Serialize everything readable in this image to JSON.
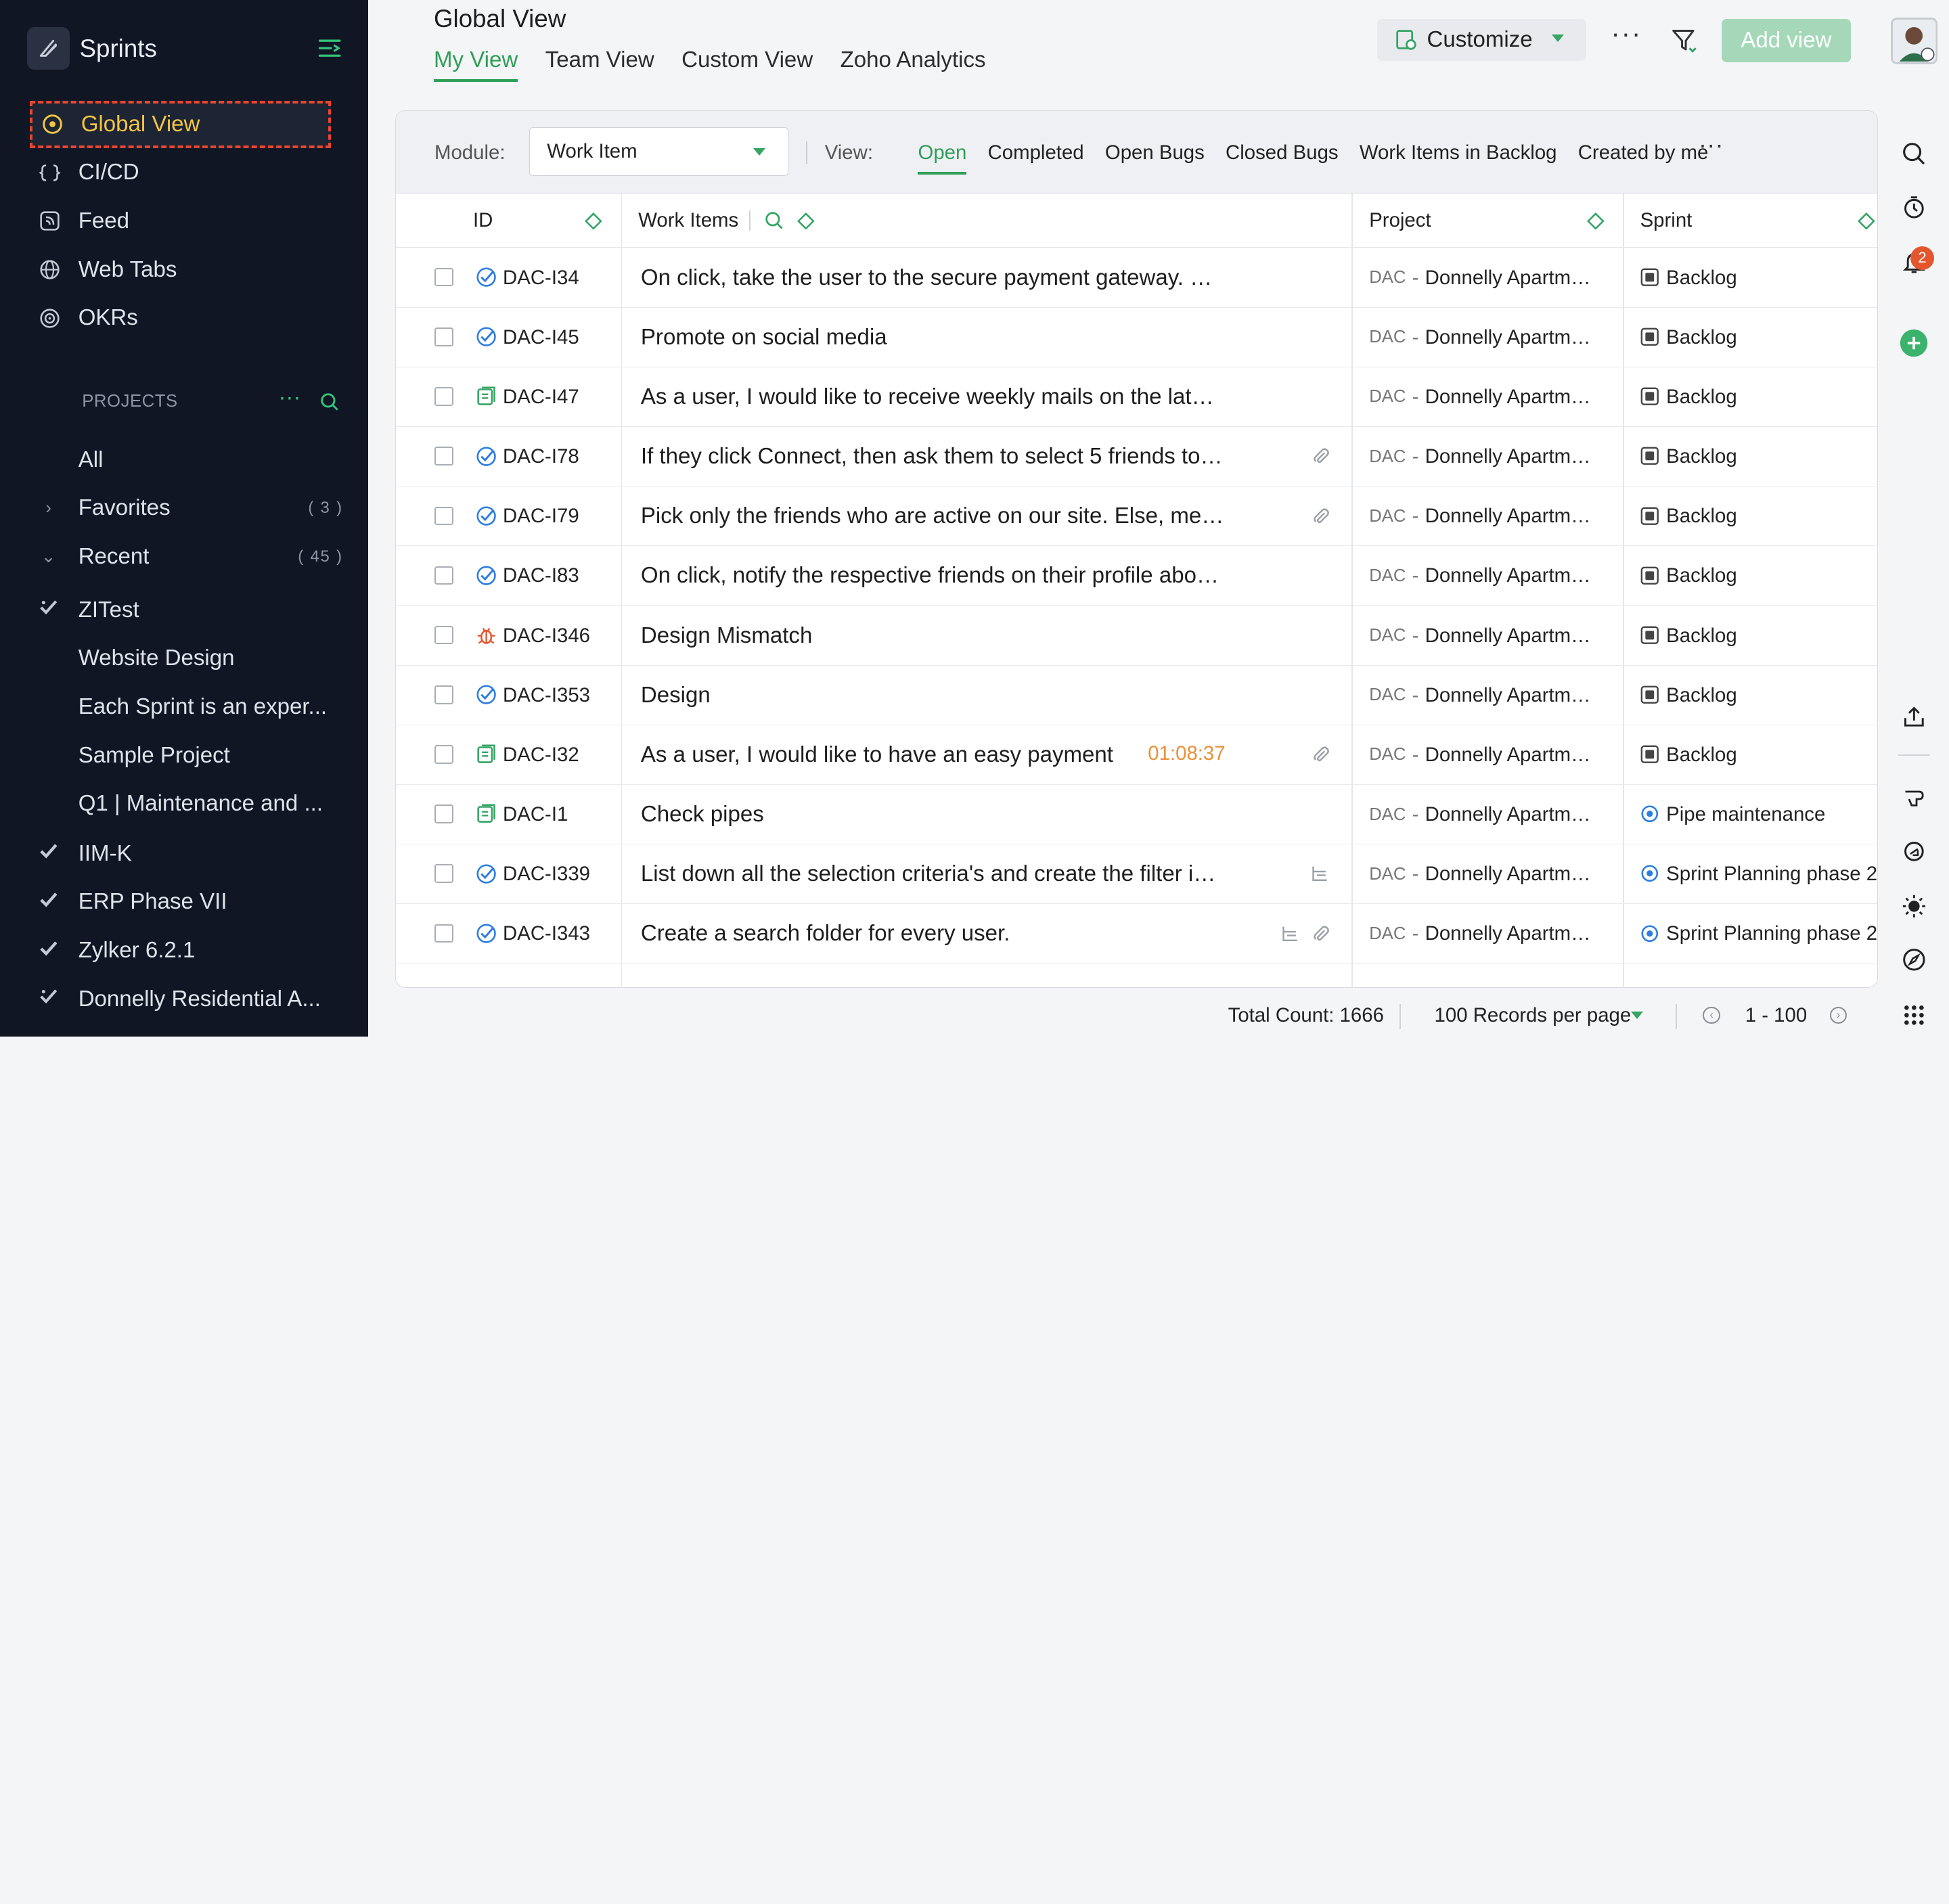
{
  "app": {
    "name": "Sprints"
  },
  "sidebar": {
    "nav": [
      {
        "label": "Global View",
        "icon": "eye-icon",
        "active": true
      },
      {
        "label": "CI/CD",
        "icon": "code-braces-icon"
      },
      {
        "label": "Feed",
        "icon": "feed-icon"
      },
      {
        "label": "Web Tabs",
        "icon": "globe-icon"
      },
      {
        "label": "OKRs",
        "icon": "target-icon"
      }
    ],
    "projects_heading": "PROJECTS",
    "groups": [
      {
        "label": "All"
      },
      {
        "label": "Favorites",
        "count": "( 3 )"
      },
      {
        "label": "Recent",
        "count": "( 45 )"
      }
    ],
    "projects": [
      {
        "label": "ZITest",
        "icon": "checkmark-star-icon"
      },
      {
        "label": "Website Design"
      },
      {
        "label": "Each Sprint is an exper..."
      },
      {
        "label": "Sample Project"
      },
      {
        "label": "Q1 | Maintenance and ..."
      },
      {
        "label": "IIM-K",
        "icon": "checkmark-icon"
      },
      {
        "label": "ERP Phase VII",
        "icon": "checkmark-icon"
      },
      {
        "label": "Zylker 6.2.1",
        "icon": "checkmark-icon"
      },
      {
        "label": "Donnelly Residential A...",
        "icon": "checkmark-star-icon"
      }
    ]
  },
  "header": {
    "title": "Global View",
    "tabs": [
      "My View",
      "Team View",
      "Custom View",
      "Zoho Analytics"
    ],
    "customize_label": "Customize",
    "add_view_label": "Add view"
  },
  "toolbar": {
    "module_label": "Module:",
    "module_value": "Work Item",
    "view_label": "View:",
    "views": [
      "Open",
      "Completed",
      "Open Bugs",
      "Closed Bugs",
      "Work Items in Backlog",
      "Created by me"
    ]
  },
  "table": {
    "columns": [
      "ID",
      "Work Items",
      "Project",
      "Sprint"
    ],
    "rows": [
      {
        "type": "task",
        "id": "DAC-I34",
        "title": "On click, take the user to the secure payment gateway. Che...",
        "project_prefix": "DAC",
        "project": "Donnelly Apartmen...",
        "sprint": "Backlog",
        "sprint_type": "backlog"
      },
      {
        "type": "task",
        "id": "DAC-I45",
        "title": "Promote on social media",
        "project_prefix": "DAC",
        "project": "Donnelly Apartmen...",
        "sprint": "Backlog",
        "sprint_type": "backlog"
      },
      {
        "type": "story",
        "id": "DAC-I47",
        "title": "As a user, I would like to receive weekly mails on the latest ...",
        "project_prefix": "DAC",
        "project": "Donnelly Apartmen...",
        "sprint": "Backlog",
        "sprint_type": "backlog"
      },
      {
        "type": "task",
        "id": "DAC-I78",
        "title": "If they click Connect, then ask them to select 5 friends to in...",
        "attach": true,
        "project_prefix": "DAC",
        "project": "Donnelly Apartmen...",
        "sprint": "Backlog",
        "sprint_type": "backlog"
      },
      {
        "type": "task",
        "id": "DAC-I79",
        "title": "Pick only the friends who are active on our site. Else, menti...",
        "attach": true,
        "project_prefix": "DAC",
        "project": "Donnelly Apartmen...",
        "sprint": "Backlog",
        "sprint_type": "backlog"
      },
      {
        "type": "task",
        "id": "DAC-I83",
        "title": "On click, notify the respective friends on their profile about...",
        "project_prefix": "DAC",
        "project": "Donnelly Apartmen...",
        "sprint": "Backlog",
        "sprint_type": "backlog"
      },
      {
        "type": "bug",
        "id": "DAC-I346",
        "title": "Design Mismatch",
        "project_prefix": "DAC",
        "project": "Donnelly Apartmen...",
        "sprint": "Backlog",
        "sprint_type": "backlog"
      },
      {
        "type": "task",
        "id": "DAC-I353",
        "title": "Design",
        "project_prefix": "DAC",
        "project": "Donnelly Apartmen...",
        "sprint": "Backlog",
        "sprint_type": "backlog"
      },
      {
        "type": "story",
        "id": "DAC-I32",
        "title": "As a user, I would like to have an easy payment",
        "timer": "01:08:37",
        "attach": true,
        "project_prefix": "DAC",
        "project": "Donnelly Apartmen...",
        "sprint": "Backlog",
        "sprint_type": "backlog"
      },
      {
        "type": "story",
        "id": "DAC-I1",
        "title": "Check pipes",
        "project_prefix": "DAC",
        "project": "Donnelly Apartmen...",
        "sprint": "Pipe maintenance",
        "sprint_type": "sprint"
      },
      {
        "type": "task",
        "id": "DAC-I339",
        "title": "List down all the selection criteria's and create the filter icon",
        "subtask": true,
        "project_prefix": "DAC",
        "project": "Donnelly Apartmen...",
        "sprint": "Sprint Planning phase 2",
        "sprint_type": "sprint"
      },
      {
        "type": "task",
        "id": "DAC-I343",
        "title": "Create a search folder for every user.",
        "subtask": true,
        "attach": true,
        "project_prefix": "DAC",
        "project": "Donnelly Apartmen...",
        "sprint": "Sprint Planning phase 2",
        "sprint_type": "sprint"
      }
    ]
  },
  "footer": {
    "total": "Total Count: 1666",
    "per_page": "100 Records per page",
    "range": "1 - 100"
  },
  "rail": {
    "notification_count": "2"
  },
  "colors": {
    "accent": "#2f9e58",
    "sidebar_bg": "#101624",
    "active_nav": "#f4c542",
    "bug": "#e4572e",
    "task": "#2d7de0"
  }
}
